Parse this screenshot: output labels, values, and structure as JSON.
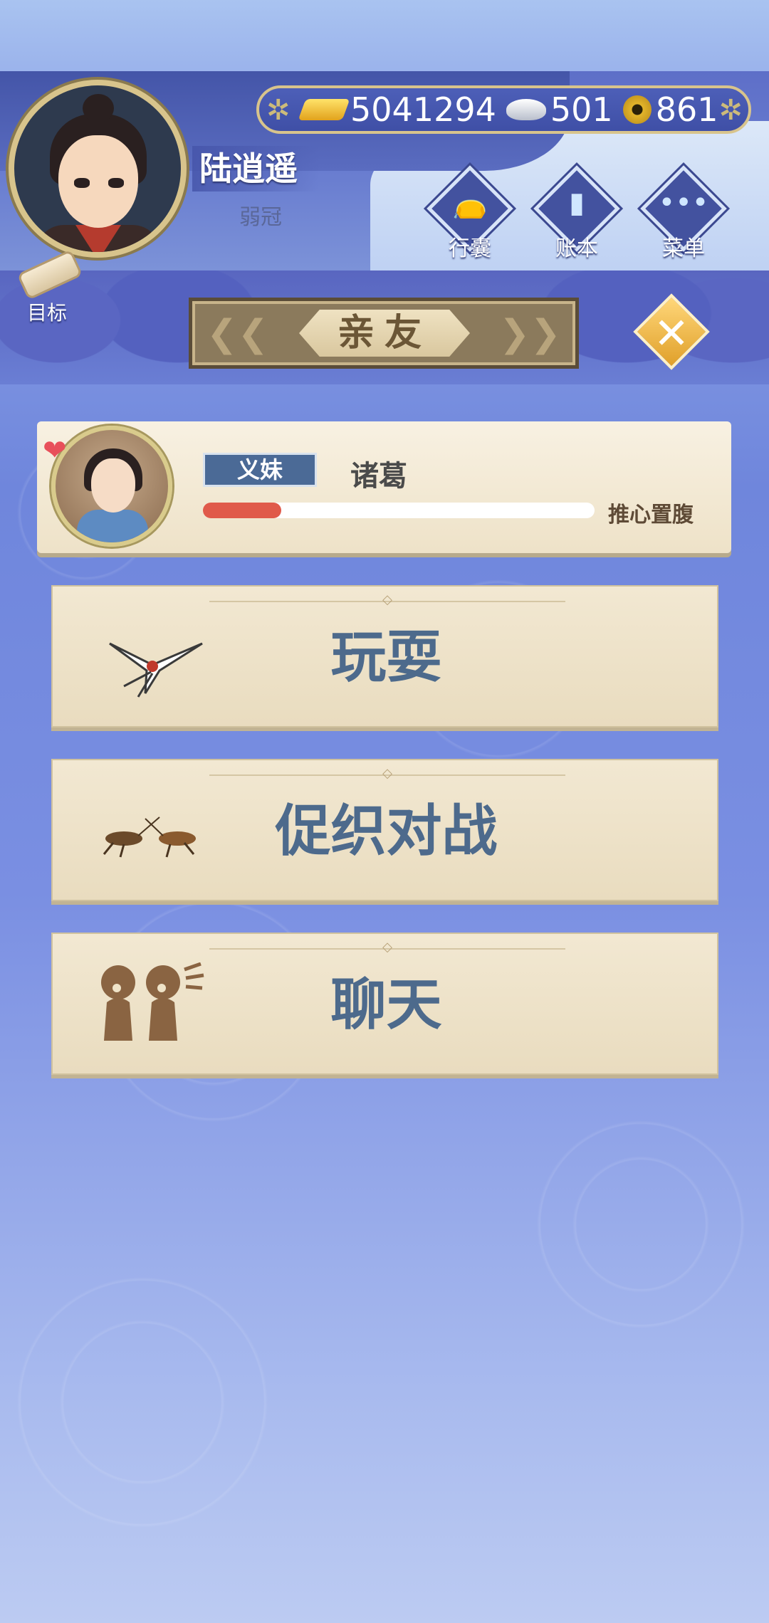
{
  "player": {
    "name": "陆逍遥",
    "age_title": "弱冠"
  },
  "currency": {
    "gold": "5041294",
    "silver": "501",
    "coins": "861"
  },
  "top_buttons": [
    {
      "label": "行囊",
      "icon": "bag-icon"
    },
    {
      "label": "账本",
      "icon": "ledger-icon"
    },
    {
      "label": "菜单",
      "icon": "menu-dots-icon"
    }
  ],
  "target": {
    "label": "目标",
    "icon": "scroll-icon"
  },
  "section_title": "亲友",
  "relation": {
    "tag": "义妹",
    "name": "诸葛",
    "level_text": "推心置腹",
    "progress": 0.2,
    "bar_color": "#e05a4a"
  },
  "actions": [
    {
      "label": "玩耍",
      "icon": "swallow-kite-icon"
    },
    {
      "label": "促织对战",
      "icon": "cricket-icon"
    },
    {
      "label": "聊天",
      "icon": "chat-people-icon"
    }
  ]
}
